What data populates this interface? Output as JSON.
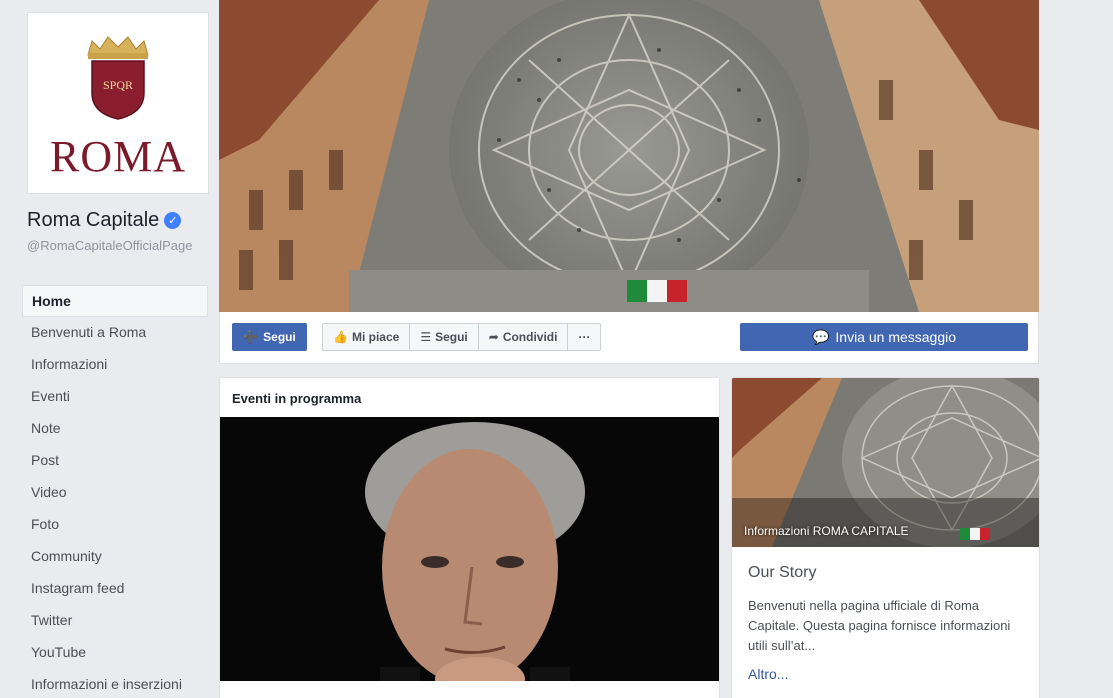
{
  "page": {
    "logo_text": "ROMA",
    "logo_shield_text": "SPQR",
    "name": "Roma Capitale",
    "handle": "@RomaCapitaleOfficialPage"
  },
  "nav": [
    {
      "label": "Home",
      "active": true
    },
    {
      "label": "Benvenuti a Roma"
    },
    {
      "label": "Informazioni"
    },
    {
      "label": "Eventi"
    },
    {
      "label": "Note"
    },
    {
      "label": "Post"
    },
    {
      "label": "Video"
    },
    {
      "label": "Foto"
    },
    {
      "label": "Community"
    },
    {
      "label": "Instagram feed"
    },
    {
      "label": "Twitter"
    },
    {
      "label": "YouTube"
    },
    {
      "label": "Informazioni e inserzioni"
    }
  ],
  "actions": {
    "follow_primary": "Segui",
    "like": "Mi piace",
    "follow": "Segui",
    "share": "Condividi",
    "more": "···",
    "message": "Invia un messaggio"
  },
  "events": {
    "title": "Eventi in programma"
  },
  "about": {
    "image_caption": "Informazioni ROMA CAPITALE",
    "story_title": "Our Story",
    "story_text": "Benvenuti nella pagina ufficiale di Roma Capitale. Questa pagina fornisce informazioni utili sull’at...",
    "more_link": "Altro..."
  },
  "colors": {
    "brand_blue": "#4267b2",
    "roma_red": "#7b1a2a",
    "link": "#365899"
  }
}
